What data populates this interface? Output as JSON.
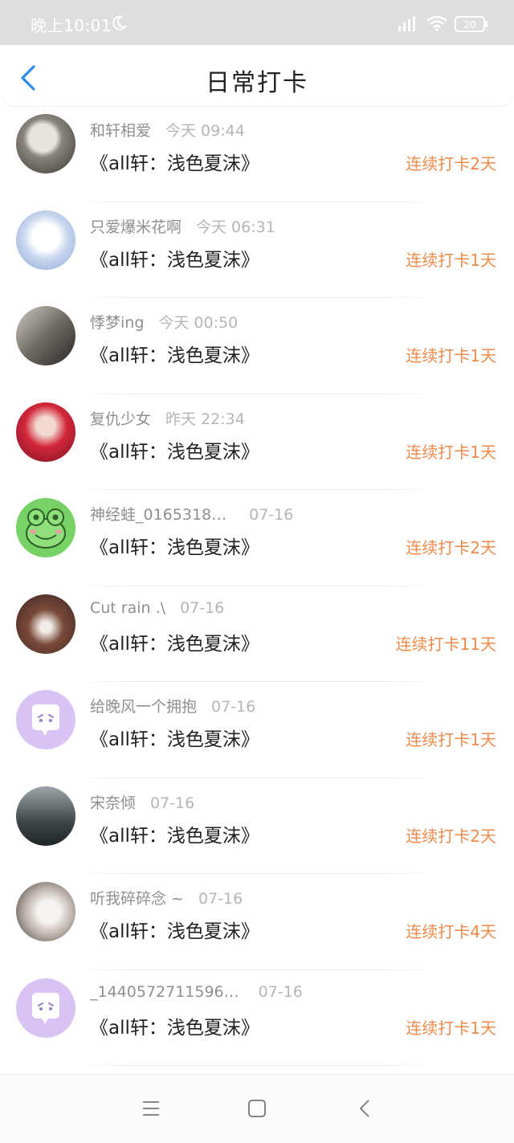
{
  "status_bar": {
    "time": "晚上10:01",
    "battery": "20"
  },
  "header": {
    "title": "日常打卡"
  },
  "entries": [
    {
      "name": "和轩相爱",
      "time": "今天 09:44",
      "message": "《all轩：浅色夏沫》",
      "streak": "连续打卡2天"
    },
    {
      "name": "只爱爆米花啊",
      "time": "今天 06:31",
      "message": "《all轩：浅色夏沫》",
      "streak": "连续打卡1天"
    },
    {
      "name": "悸梦ing",
      "time": "今天 00:50",
      "message": "《all轩：浅色夏沫》",
      "streak": "连续打卡1天"
    },
    {
      "name": "复仇少女",
      "time": "昨天 22:34",
      "message": "《all轩：浅色夏沫》",
      "streak": "连续打卡1天"
    },
    {
      "name": "神经蛙_0165318…",
      "time": "07-16",
      "message": "《all轩：浅色夏沫》",
      "streak": "连续打卡2天"
    },
    {
      "name": "Cut rain .\\",
      "time": "07-16",
      "message": "《all轩：浅色夏沫》",
      "streak": "连续打卡11天"
    },
    {
      "name": "给晚风一个拥抱",
      "time": "07-16",
      "message": "《all轩：浅色夏沫》",
      "streak": "连续打卡1天"
    },
    {
      "name": "宋奈倾",
      "time": "07-16",
      "message": "《all轩：浅色夏沫》",
      "streak": "连续打卡2天"
    },
    {
      "name": "听我碎碎念 ~",
      "time": "07-16",
      "message": "《all轩：浅色夏沫》",
      "streak": "连续打卡4天"
    },
    {
      "name": "_1440572711596…",
      "time": "07-16",
      "message": "《all轩：浅色夏沫》",
      "streak": "连续打卡1天"
    }
  ],
  "colors": {
    "streak": "#ee8a4a",
    "back_arrow": "#2a8cf0",
    "default_avatar": "#d9c3f4"
  },
  "icons": {
    "back": "chevron-left-icon",
    "nav_menu": "menu-icon",
    "nav_home": "home-square-icon",
    "nav_back": "back-chevron-icon"
  }
}
